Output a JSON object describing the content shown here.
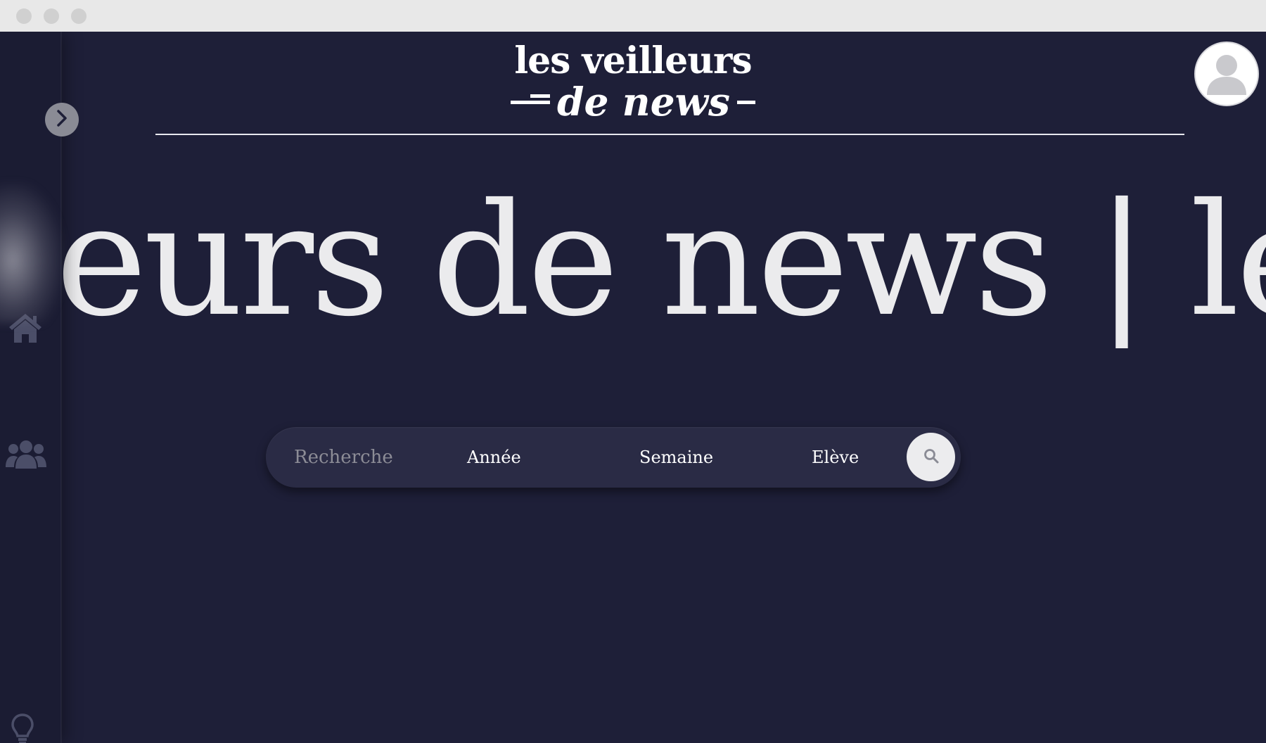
{
  "logo": {
    "line1": "les veilleurs",
    "line2": "de news"
  },
  "marquee": {
    "text": "eurs de news | les v"
  },
  "search": {
    "placeholder": "Recherche",
    "filters": {
      "year": "Année",
      "week": "Semaine",
      "student": "Elève"
    }
  },
  "icons": {
    "toggle": "chevron-right-icon",
    "home": "home-icon",
    "users": "users-icon",
    "idea": "lightbulb-icon",
    "search": "search-icon",
    "avatar": "user-avatar-icon"
  },
  "colors": {
    "background": "#1e1f38",
    "text": "#ebebed",
    "accent": "#ffffff"
  }
}
